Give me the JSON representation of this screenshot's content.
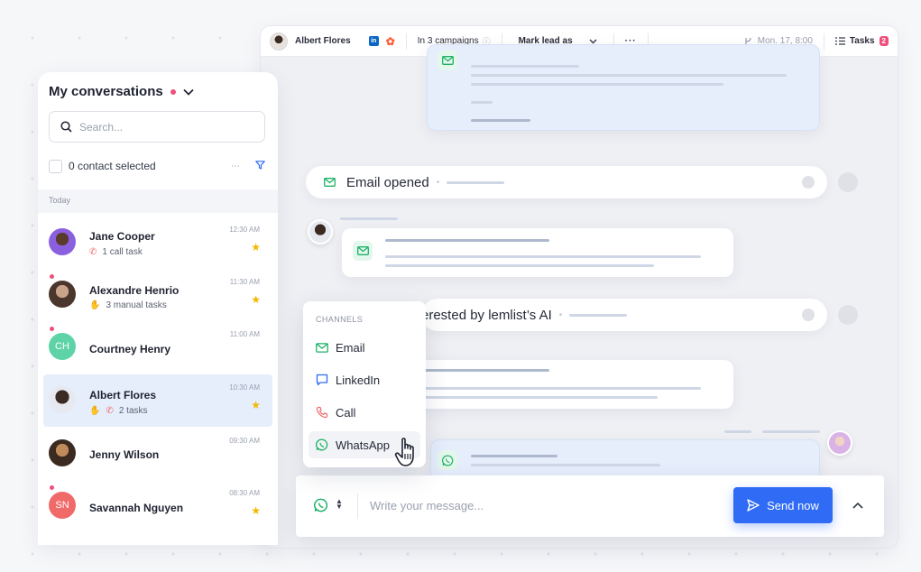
{
  "topbar": {
    "contact_name": "Albert Flores",
    "campaigns": "In 3 campaigns",
    "mark_lead": "Mark lead as",
    "more": "···",
    "date": "Mon. 17, 8:00",
    "tasks_label": "Tasks",
    "tasks_count": "2"
  },
  "feed": {
    "email_opened": "Email opened",
    "ai_event": "erested by lemlist’s AI"
  },
  "channels": {
    "title": "CHANNELS",
    "items": [
      {
        "label": "Email",
        "icon": "mail-icon"
      },
      {
        "label": "LinkedIn",
        "icon": "chat-bubble-icon"
      },
      {
        "label": "Call",
        "icon": "phone-icon"
      },
      {
        "label": "WhatsApp",
        "icon": "whatsapp-icon",
        "active": true
      }
    ]
  },
  "composer": {
    "placeholder": "Write your message...",
    "send_label": "Send now"
  },
  "conversations_panel": {
    "title": "My conversations",
    "search_placeholder": "Search...",
    "selected_text": "0 contact selected",
    "group_label": "Today",
    "items": [
      {
        "name": "Jane Cooper",
        "sub": "1 call task",
        "time": "12:30 AM",
        "starred": true,
        "unread": false,
        "initials": "",
        "avatar_color": "#7a4fd6"
      },
      {
        "name": "Alexandre Henrio",
        "sub": "3 manual tasks",
        "time": "11:30 AM",
        "starred": true,
        "unread": true,
        "initials": "",
        "avatar_color": "#5a4236"
      },
      {
        "name": "Courtney Henry",
        "sub": "",
        "time": "11:00 AM",
        "starred": false,
        "unread": true,
        "initials": "CH",
        "avatar_color": "#5fd3a8"
      },
      {
        "name": "Albert Flores",
        "sub": "2 tasks",
        "time": "10:30 AM",
        "starred": true,
        "unread": false,
        "initials": "",
        "avatar_color": "#3a2a22",
        "selected": true
      },
      {
        "name": "Jenny Wilson",
        "sub": "",
        "time": "09:30 AM",
        "starred": false,
        "unread": false,
        "initials": "",
        "avatar_color": "#b47a3c"
      },
      {
        "name": "Savannah Nguyen",
        "sub": "",
        "time": "08:30 AM",
        "starred": true,
        "unread": true,
        "initials": "SN",
        "avatar_color": "#f06a6a"
      }
    ]
  },
  "colors": {
    "accent": "#2f6bf5",
    "whatsapp": "#1fb268",
    "unread": "#ef4f7d",
    "star": "#f2b800"
  }
}
